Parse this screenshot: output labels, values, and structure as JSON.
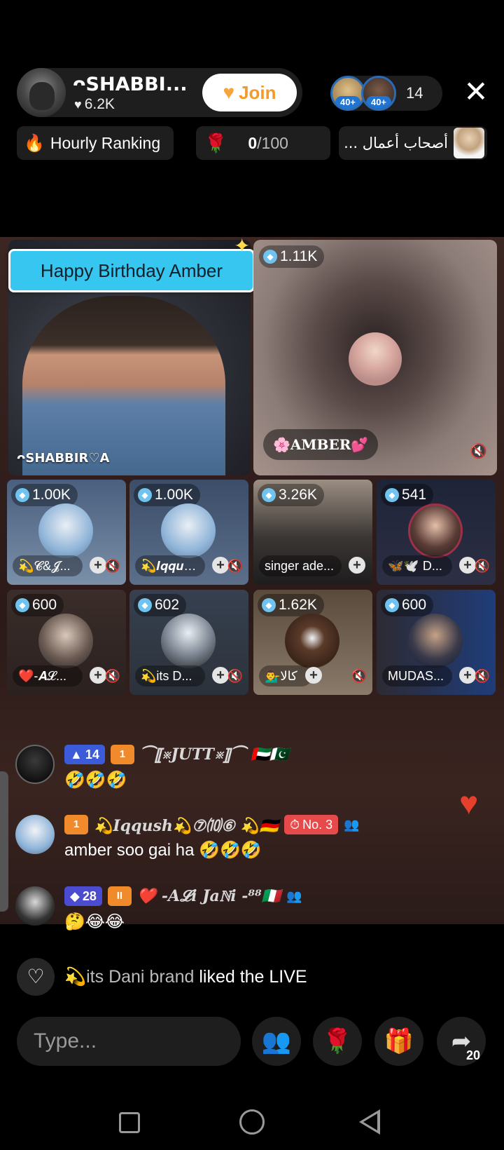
{
  "header": {
    "host_name": "ᴖSHABBI...",
    "host_likes": "6.2K",
    "join_label": "Join",
    "viewer_level_1": "40+",
    "viewer_level_2": "40+",
    "viewer_count": "14",
    "close_icon": "close-icon"
  },
  "chips": {
    "hourly_ranking": "Hourly Ranking",
    "rose_current": "0",
    "rose_total": "/100",
    "arabic_room": "... أصحاب أعمال"
  },
  "stage": {
    "banner": "Happy Birthday Amber",
    "host_label": "ᴖSHABBIR♡A",
    "guest_main": {
      "coins": "1.11K",
      "name": "🌸AMBER💕"
    },
    "seats": [
      {
        "coins": "1.00K",
        "name": "💫𝓒&𝓙..."
      },
      {
        "coins": "1.00K",
        "name": "💫𝑰𝒒𝒒𝒖𝒔𝒉 ..."
      },
      {
        "coins": "3.26K",
        "name": "singer ade..."
      },
      {
        "coins": "541",
        "name": "🦋🕊️ D..."
      },
      {
        "coins": "600",
        "name": "❤️-𝑨𝓛..."
      },
      {
        "coins": "602",
        "name": "💫its D..."
      },
      {
        "coins": "1.62K",
        "name": "کالا💁‍♂️"
      },
      {
        "coins": "600",
        "name": "MUDAS..."
      }
    ]
  },
  "chat": [
    {
      "level": "14",
      "fan": "1",
      "username": "⏜⟦※JUTT※⟧⏜ 🇦🇪🇵🇰",
      "message": "🤣🤣🤣"
    },
    {
      "fan": "1",
      "username": "💫𝑰𝒒𝒒𝒖𝒔𝒉💫⑦⑽⑥ 💫🇩🇪",
      "rank": "No. 3",
      "message": "amber soo gai ha 🤣🤣🤣"
    },
    {
      "level": "28",
      "fan": "II",
      "username": "❤️ -𝑨𝓛𝒊 Jaℕ𝒊 -⁸⁸🇮🇹",
      "message": "🤔😂😂"
    }
  ],
  "bottom": {
    "liked_user": "💫its Dani brand",
    "liked_suffix": " liked the LIVE",
    "type_placeholder": "Type...",
    "share_count": "20"
  },
  "colors": {
    "accent_join": "#f39a2c",
    "banner": "#36c6ef",
    "level_badge": "#3b5bd8",
    "fan_badge": "#f08a2a",
    "rank_badge": "#e74a4a"
  }
}
